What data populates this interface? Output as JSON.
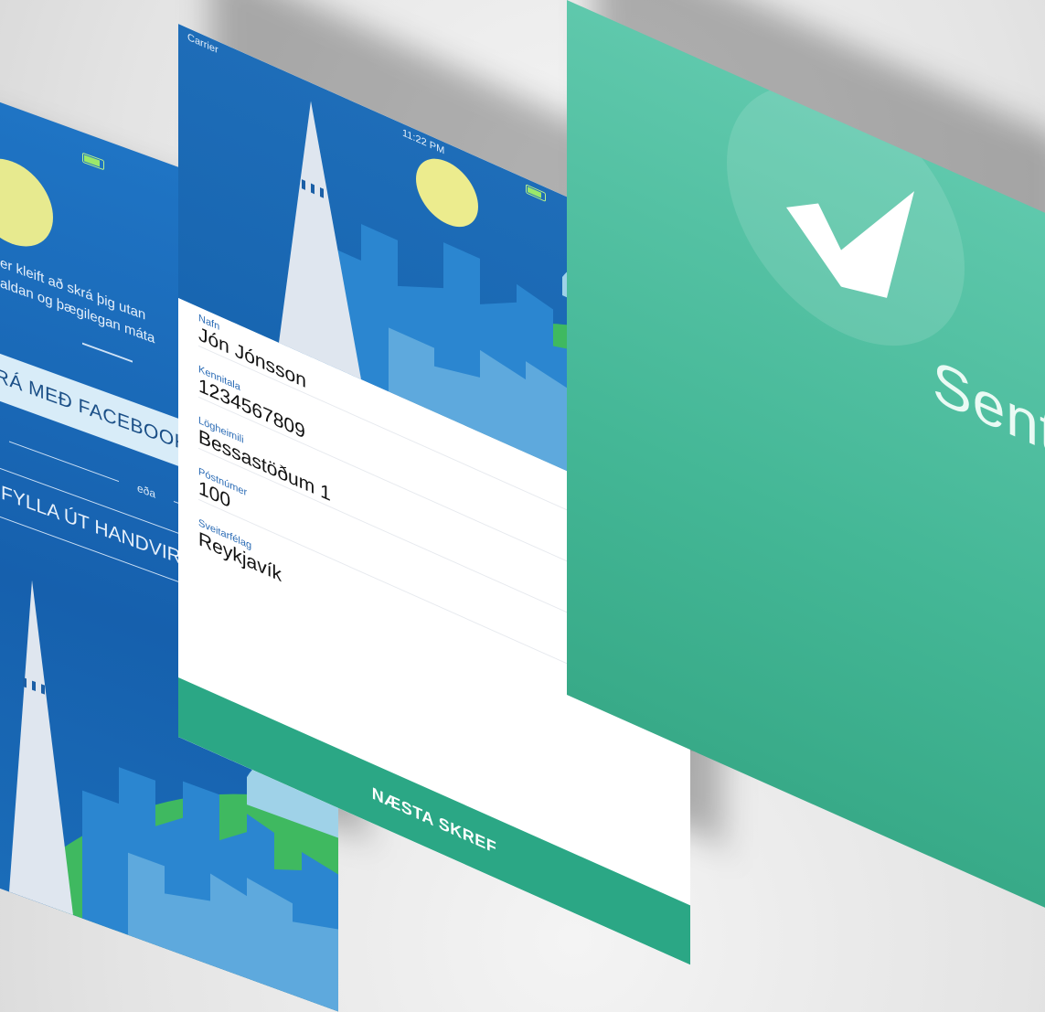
{
  "left_screen": {
    "intro_line1": "er kleift að skrá þig utan",
    "intro_line2": "aldan og þægilegan máta",
    "facebook_button": "NSKRÁ MEÐ FACEBOOK",
    "or_label": "eða",
    "manual_button": "FYLLA ÚT HANDVIRKT"
  },
  "middle_screen": {
    "status": {
      "carrier": "Carrier",
      "time": "11:22 PM"
    },
    "fields": [
      {
        "label": "Nafn",
        "value": "Jón Jónsson"
      },
      {
        "label": "Kennitala",
        "value": "1234567809"
      },
      {
        "label": "Lögheimili",
        "value": "Bessastöðum 1"
      },
      {
        "label": "Póstnúmer",
        "value": "100"
      },
      {
        "label": "Sveitarfélag",
        "value": "Reykjavík"
      }
    ],
    "next_button": "NÆSTA SKREF"
  },
  "right_screen": {
    "sent_label": "Sent",
    "check_icon": "checkmark-icon"
  },
  "colors": {
    "blue": "#1f74c4",
    "light_blue": "#5ea9dd",
    "green_hill": "#3fb960",
    "church": "#dfe6ef",
    "sun": "#e7ea8f",
    "teal": "#2ba785",
    "teal_light": "#5fc8ac"
  }
}
